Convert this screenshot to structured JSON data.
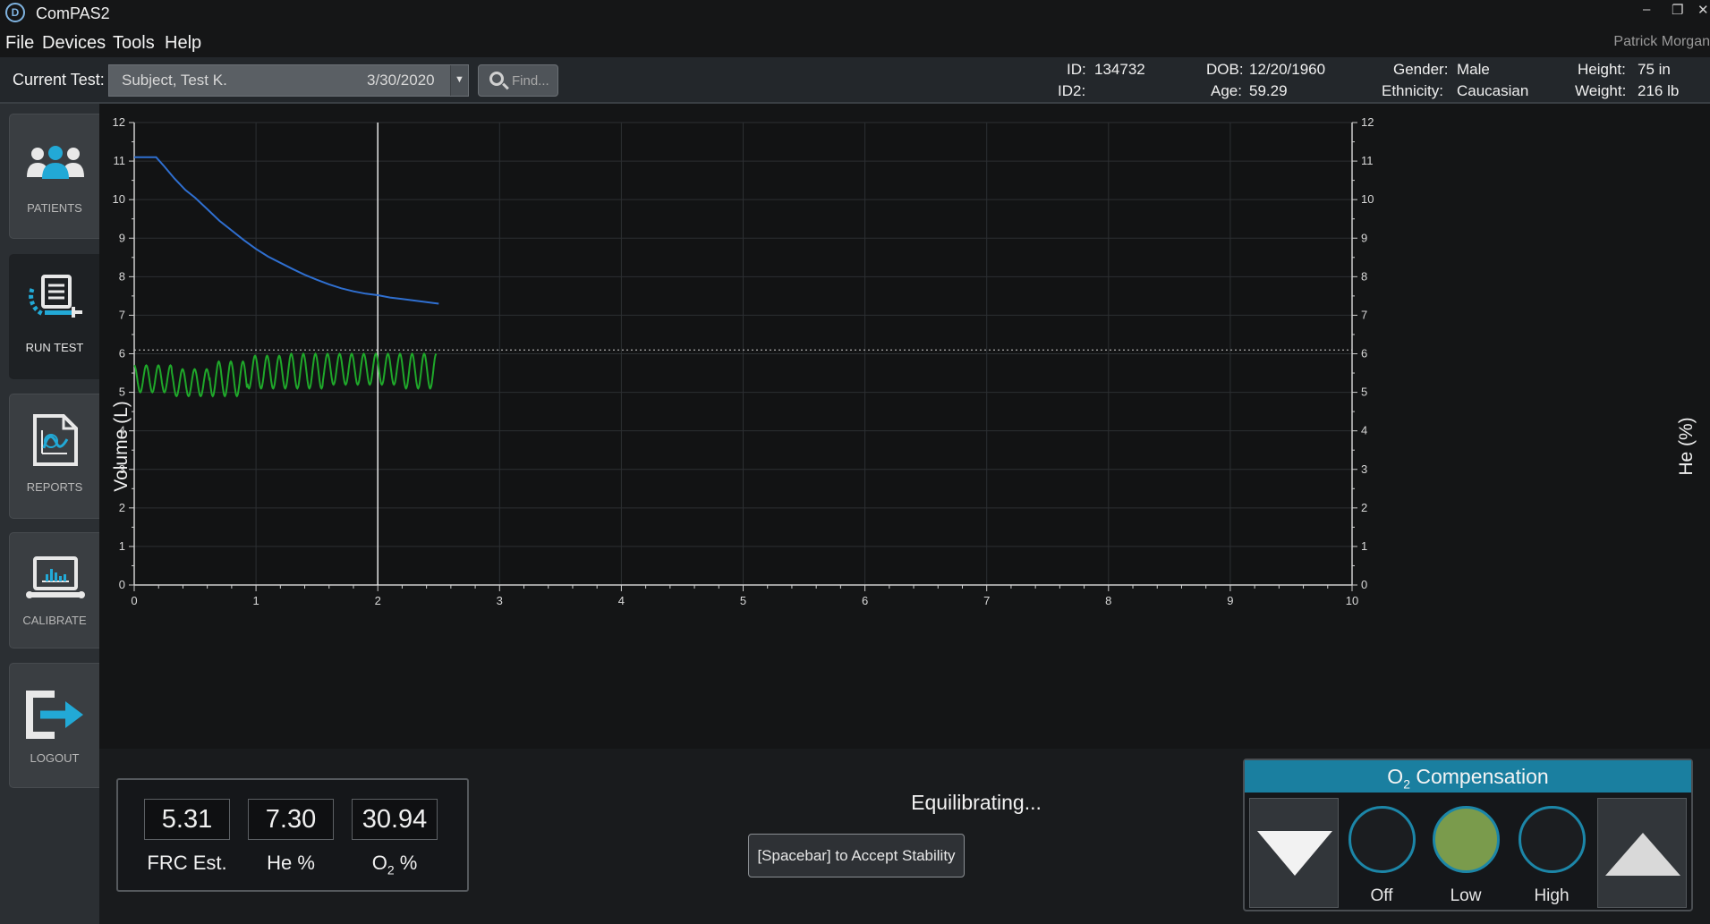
{
  "window": {
    "title": "ComPAS2",
    "logo_glyph": "D",
    "minimize": "–",
    "maximize": "❐",
    "close": "✕"
  },
  "menu": {
    "items": [
      "File",
      "Devices",
      "Tools",
      "Help"
    ],
    "user": "Patrick Morgan"
  },
  "header": {
    "current_test_label": "Current Test:",
    "test_subject": "Subject, Test K.",
    "test_date": "3/30/2020",
    "find_placeholder": "Find...",
    "id_label": "ID:",
    "id_value": "134732",
    "id2_label": "ID2:",
    "id2_value": "",
    "dob_label": "DOB:",
    "dob_value": "12/20/1960",
    "age_label": "Age:",
    "age_value": "59.29",
    "gender_label": "Gender:",
    "gender_value": "Male",
    "ethnicity_label": "Ethnicity:",
    "ethnicity_value": "Caucasian",
    "height_label": "Height:",
    "height_value": "75 in",
    "weight_label": "Weight:",
    "weight_value": "216 lb"
  },
  "sidebar": {
    "items": [
      {
        "label": "PATIENTS",
        "icon": "patients-icon",
        "active": false
      },
      {
        "label": "RUN TEST",
        "icon": "run-test-icon",
        "active": true
      },
      {
        "label": "REPORTS",
        "icon": "reports-icon",
        "active": false
      },
      {
        "label": "CALIBRATE",
        "icon": "calibrate-icon",
        "active": false
      },
      {
        "label": "LOGOUT",
        "icon": "logout-icon",
        "active": false
      }
    ]
  },
  "chart_data": {
    "type": "line",
    "title": "",
    "xlabel": "",
    "ylabel": "Volume (L)",
    "y2label": "He (%)",
    "xlim": [
      0,
      10
    ],
    "ylim": [
      0,
      12
    ],
    "y2lim": [
      0,
      12
    ],
    "x_ticks": [
      "0",
      "1",
      "2",
      "3",
      "4",
      "5",
      "6",
      "7",
      "8",
      "9",
      "10"
    ],
    "y_ticks": [
      "0",
      "1",
      "2",
      "3",
      "4",
      "5",
      "6",
      "7",
      "8",
      "9",
      "10",
      "11",
      "12"
    ],
    "y2_ticks": [
      "0",
      "1",
      "2",
      "3",
      "4",
      "5",
      "6",
      "7",
      "8",
      "9",
      "10",
      "11",
      "12"
    ],
    "grid": true,
    "cursor_x": 2.0,
    "reference_line_y": 6.1,
    "series": [
      {
        "color": "#2f6fd0",
        "axis": "y2",
        "x": [
          0,
          0.08,
          0.18,
          0.25,
          0.33,
          0.42,
          0.5,
          0.6,
          0.7,
          0.8,
          0.9,
          1.0,
          1.1,
          1.2,
          1.3,
          1.4,
          1.5,
          1.6,
          1.7,
          1.8,
          1.9,
          2.0,
          2.1,
          2.2,
          2.3,
          2.4,
          2.5
        ],
        "values": [
          11.1,
          11.1,
          11.1,
          10.85,
          10.55,
          10.25,
          10.05,
          9.75,
          9.45,
          9.2,
          8.95,
          8.72,
          8.52,
          8.36,
          8.2,
          8.05,
          7.92,
          7.8,
          7.7,
          7.62,
          7.56,
          7.52,
          7.46,
          7.42,
          7.38,
          7.34,
          7.3
        ]
      },
      {
        "color": "#1fa82a",
        "axis": "y",
        "type": "oscillation",
        "x_start": 0,
        "x_end": 2.48,
        "cycles": 25,
        "min": [
          5.0,
          4.9,
          4.9,
          5.1,
          5.1,
          5.2,
          5.2,
          5.1
        ],
        "max": [
          5.7,
          5.6,
          5.8,
          5.95,
          6.0,
          6.0,
          6.0,
          6.0
        ]
      }
    ]
  },
  "readouts": [
    {
      "value": "5.31",
      "label": "FRC Est."
    },
    {
      "value": "7.30",
      "label": "He %"
    },
    {
      "value": "30.94",
      "label_main": "O",
      "label_sub": "2",
      "label_tail": " %"
    }
  ],
  "status": {
    "text": "Equilibrating...",
    "accept_button": "[Spacebar] to Accept Stability"
  },
  "o2_compensation": {
    "title_main": "O",
    "title_sub": "2",
    "title_tail": " Compensation",
    "options": [
      "Off",
      "Low",
      "High"
    ],
    "selected": "Low",
    "decrease_icon": "triangle-down-icon",
    "increase_icon": "triangle-up-icon",
    "accent_color": "#1a7fa0",
    "selected_color": "#7a9b4c"
  }
}
